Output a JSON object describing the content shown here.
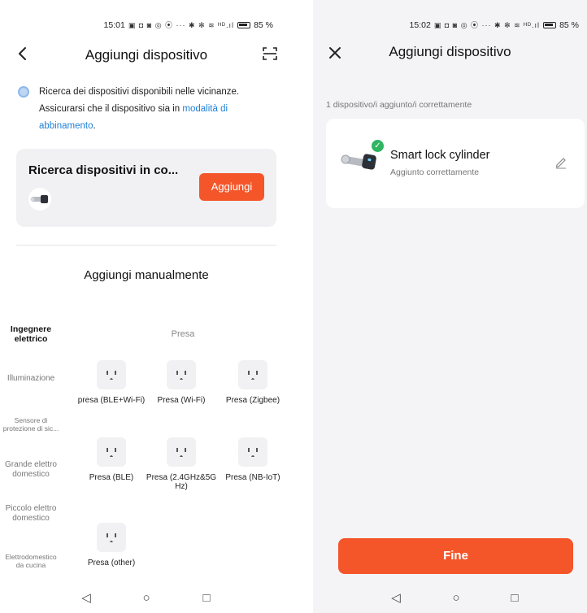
{
  "colors": {
    "accent": "#f4562a",
    "success": "#2fb560",
    "link": "#1f7fd6",
    "card_bg": "#f1f1f3",
    "page_bg_right": "#f4f4f6"
  },
  "left": {
    "status": {
      "time": "15:01",
      "icons": "▣ ◘ ◙ ◎ ⦿ ··· ✱ ✻ ≋ ᴴᴰ.ıl",
      "battery": "85 %"
    },
    "title": "Aggiungi dispositivo",
    "icons": {
      "back": "chevron-left-icon",
      "scan": "scan-icon"
    },
    "search": {
      "line1": "Ricerca dei dispositivi disponibili nelle vicinanze.",
      "line2": "Assicurarsi che il dispositivo sia in ",
      "link": "modalità di abbinamento",
      "end": "."
    },
    "scan_card": {
      "title": "Ricerca dispositivi in co...",
      "button": "Aggiungi"
    },
    "manual_title": "Aggiungi manualmente",
    "categories": [
      "Ingegnere elettrico",
      "Illuminazione",
      "Sensore di protezione di sic...",
      "Grande elettro domestico",
      "Piccolo elettro domestico",
      "Elettrodomestico da cucina"
    ],
    "section_label": "Presa",
    "devices": [
      "presa (BLE+Wi-Fi)",
      "Presa (Wi-Fi)",
      "Presa (Zigbee)",
      "Presa (BLE)",
      "Presa (2.4GHz&5G Hz)",
      "Presa (NB-IoT)",
      "Presa (other)"
    ]
  },
  "right": {
    "status": {
      "time": "15:02",
      "icons": "▣ ◘ ◙ ◎ ⦿ ··· ✱ ✻ ≋ ᴴᴰ.ıl",
      "battery": "85 %"
    },
    "title": "Aggiungi dispositivo",
    "added_count": "1 dispositivo/i aggiunto/i correttamente",
    "device": {
      "name": "Smart lock cylinder",
      "status": "Aggiunto correttamente"
    },
    "done_button": "Fine"
  },
  "sys_nav": {
    "back": "◁",
    "home": "○",
    "recents": "□"
  }
}
